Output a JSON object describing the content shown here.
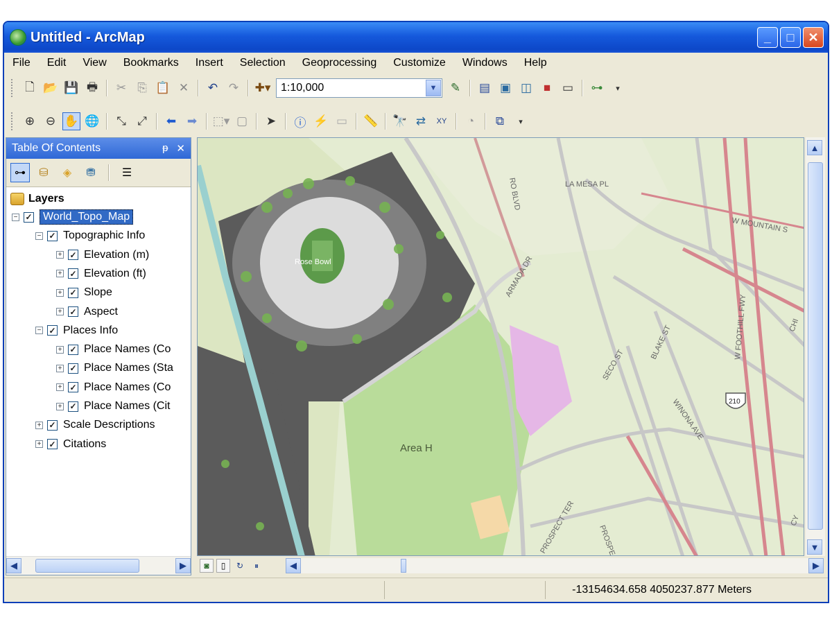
{
  "window": {
    "title": "Untitled - ArcMap",
    "buttons": {
      "minimize": "_",
      "maximize": "□",
      "close": "✕"
    }
  },
  "menu": [
    "File",
    "Edit",
    "View",
    "Bookmarks",
    "Insert",
    "Selection",
    "Geoprocessing",
    "Customize",
    "Windows",
    "Help"
  ],
  "toolbar": {
    "scale_value": "1:10,000"
  },
  "toc": {
    "title": "Table Of Contents",
    "pin": "ᵽ",
    "close": "✕",
    "layers_label": "Layers",
    "tree": [
      {
        "label": "World_Topo_Map",
        "level": 1,
        "expander": "−",
        "checked": true,
        "selected": true
      },
      {
        "label": "Topographic Info",
        "level": 2,
        "expander": "−",
        "checked": true
      },
      {
        "label": "Elevation (m)",
        "level": 3,
        "expander": "+",
        "checked": true
      },
      {
        "label": "Elevation (ft)",
        "level": 3,
        "expander": "+",
        "checked": true
      },
      {
        "label": "Slope",
        "level": 3,
        "expander": "+",
        "checked": true
      },
      {
        "label": "Aspect",
        "level": 3,
        "expander": "+",
        "checked": true
      },
      {
        "label": "Places Info",
        "level": 2,
        "expander": "−",
        "checked": true
      },
      {
        "label": "Place Names (Co",
        "level": 3,
        "expander": "+",
        "checked": true
      },
      {
        "label": "Place Names (Sta",
        "level": 3,
        "expander": "+",
        "checked": true
      },
      {
        "label": "Place Names (Co",
        "level": 3,
        "expander": "+",
        "checked": true
      },
      {
        "label": "Place Names (Cit",
        "level": 3,
        "expander": "+",
        "checked": true
      },
      {
        "label": "Scale Descriptions",
        "level": 2,
        "expander": "+",
        "checked": true
      },
      {
        "label": "Citations",
        "level": 2,
        "expander": "+",
        "checked": true
      }
    ]
  },
  "map": {
    "labels": {
      "rose_bowl": "Rose Bowl",
      "area_h": "Area H",
      "la_mesa": "LA MESA PL",
      "w_mountain": "W MOUNTAIN S",
      "armada": "ARMADA DR",
      "blake": "BLAKE ST",
      "seco": "SECO ST",
      "winona": "WINONA AVE",
      "foothill": "W FOOTHILL FWY",
      "prospect_ter": "PROSPECT TER",
      "prospect": "PROSPEC",
      "ro_blvd": "RO BLVD",
      "highway": "210",
      "chi": "CHI",
      "cy": "CY"
    }
  },
  "status": {
    "coordinates": "-13154634.658  4050237.877 Meters"
  }
}
